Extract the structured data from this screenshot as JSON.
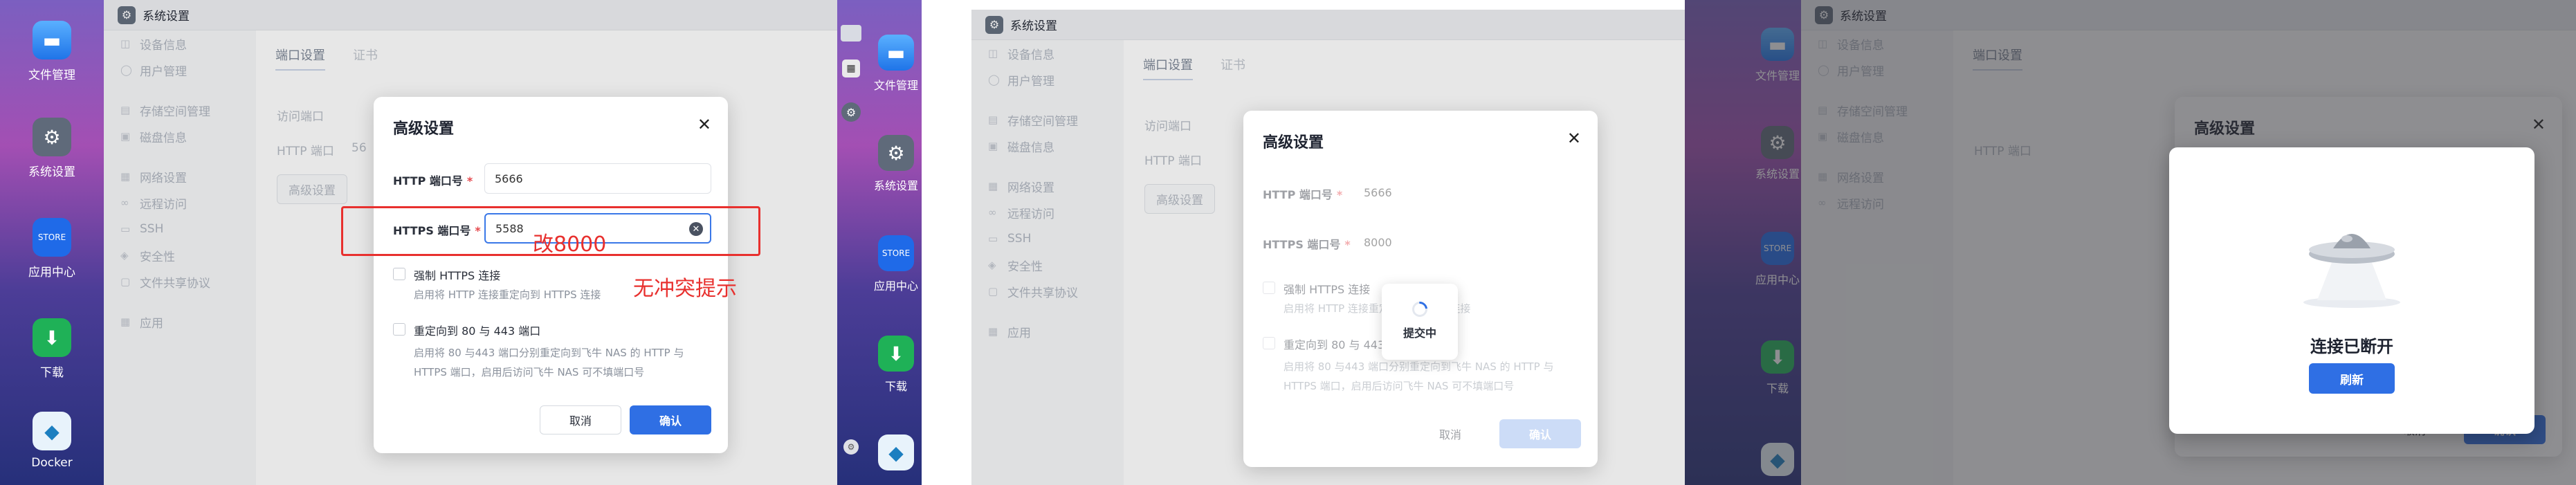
{
  "dock": {
    "items": [
      {
        "label": "文件管理",
        "icon": "folder-icon"
      },
      {
        "label": "系统设置",
        "icon": "gear-icon"
      },
      {
        "label": "应用中心",
        "icon": "store-icon"
      },
      {
        "label": "下载",
        "icon": "download-icon"
      },
      {
        "label": "Docker",
        "icon": "docker-icon"
      }
    ],
    "store_badge": "STORE"
  },
  "window": {
    "title": "系统设置"
  },
  "sidebar": {
    "items": [
      "设备信息",
      "用户管理",
      "存储空间管理",
      "磁盘信息",
      "网络设置",
      "远程访问",
      "SSH",
      "安全性",
      "文件共享协议",
      "应用"
    ]
  },
  "main": {
    "tabs": [
      "端口设置",
      "证书"
    ],
    "access_port_label": "访问端口",
    "http_port_label": "HTTP 端口",
    "http_port_partial": "56",
    "advanced_button": "高级设置"
  },
  "modal": {
    "title": "高级设置",
    "http_label": "HTTP 端口号",
    "https_label": "HTTPS 端口号",
    "required_mark": "*",
    "http_value": "5666",
    "https_value_step1": "5588",
    "https_value_step2": "8000",
    "force_https_label": "强制 HTTPS 连接",
    "force_https_hint": "启用将 HTTP 连接重定向到 HTTPS 连接",
    "redirect_label": "重定向到 80 与 443 端口",
    "redirect_hint_line1": "启用将 80 与443 端口分别重定向到飞牛 NAS 的 HTTP 与",
    "redirect_hint_line2": "HTTPS 端口，启用后访问飞牛 NAS 可不填端口号",
    "cancel": "取消",
    "confirm": "确认"
  },
  "annotations": {
    "change_to": "改8000",
    "no_conflict": "无冲突提示"
  },
  "submitting": {
    "label": "提交中"
  },
  "disconnected": {
    "title": "连接已断开",
    "refresh": "刷新"
  },
  "colors": {
    "primary": "#2f6fe4",
    "annotation": "#e8302e"
  }
}
